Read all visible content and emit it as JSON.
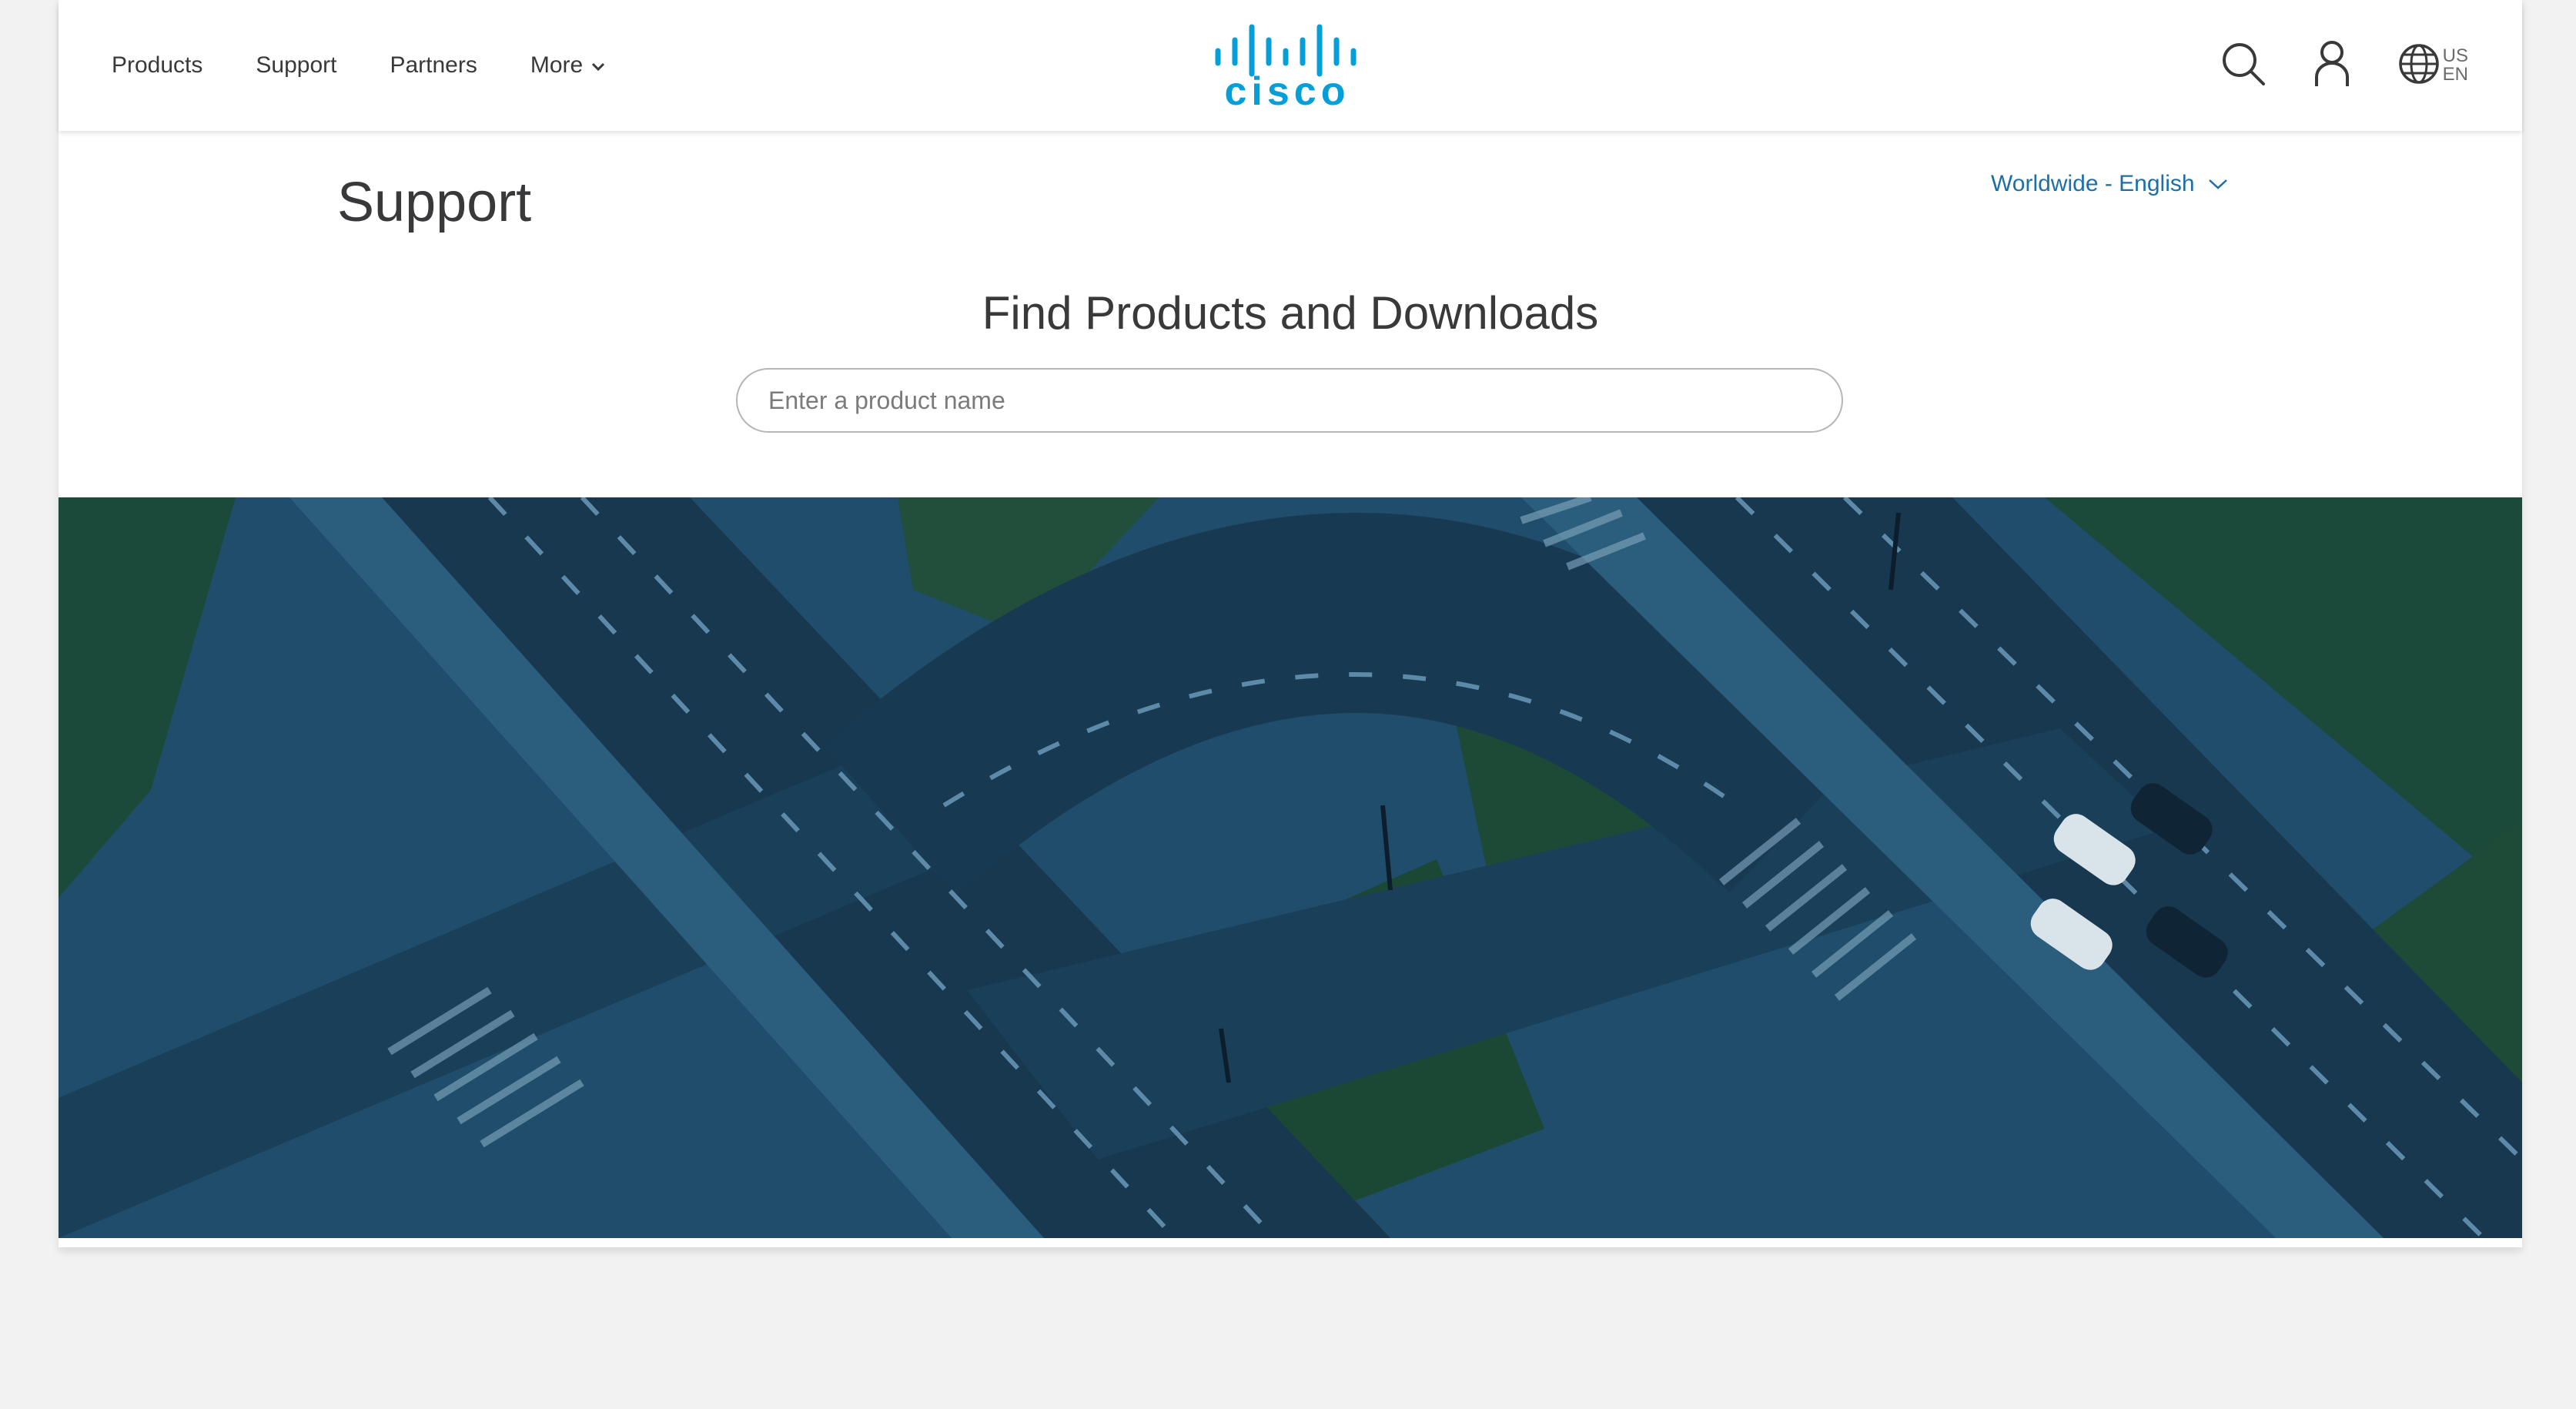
{
  "header": {
    "nav": [
      {
        "label": "Products"
      },
      {
        "label": "Support"
      },
      {
        "label": "Partners"
      },
      {
        "label": "More"
      }
    ],
    "logo_text": "cisco",
    "locale": {
      "country": "US",
      "language": "EN"
    },
    "icons": [
      "search-icon",
      "user-icon",
      "globe-icon",
      "chevron-down-icon"
    ]
  },
  "support": {
    "title": "Support",
    "language_selector": "Worldwide - English",
    "find_title": "Find Products and Downloads",
    "search_placeholder": "Enter a product name"
  },
  "colors": {
    "brand": "#049fd9",
    "link": "#1d6fa5",
    "hero_overlay": "#1f4e6e",
    "page_bg": "#f2f2f2"
  }
}
